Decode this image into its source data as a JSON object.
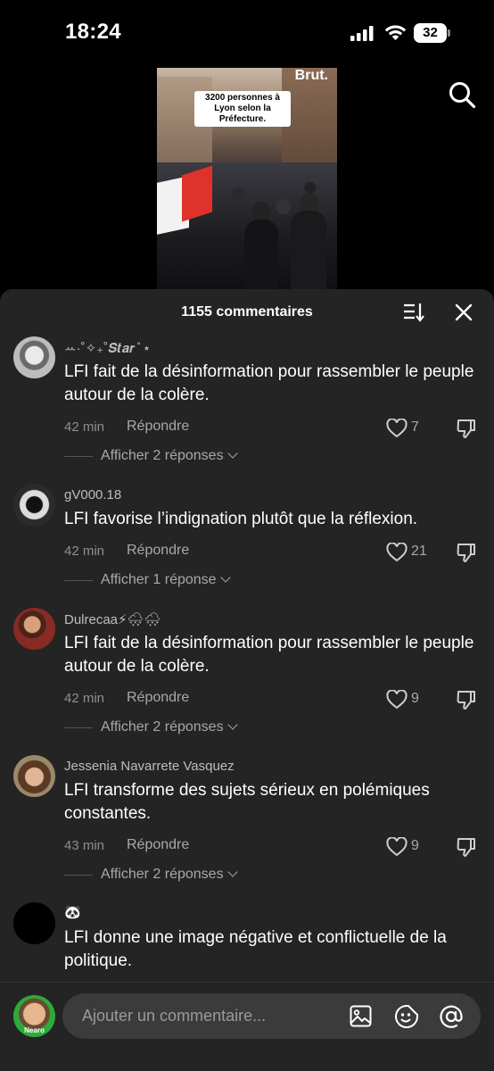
{
  "status_bar": {
    "time": "18:24",
    "battery": "32"
  },
  "video": {
    "brand": "Brut.",
    "caption": "3200 personnes à Lyon selon la Préfecture."
  },
  "sheet": {
    "comment_count": "1155 commentaires"
  },
  "comments": [
    {
      "user": "ꕀ·˚✧₊˚𝑺𝒕𝒂𝒓 ̊ ⋆",
      "text": "LFI fait de la désinformation pour rassembler le peuple autour de la colère.",
      "time": "42 min",
      "reply_label": "Répondre",
      "likes": "7",
      "show_replies": "Afficher 2 réponses"
    },
    {
      "user": "gV000.18",
      "text": "LFI favorise l’indignation plutôt que la réflexion.",
      "time": "42 min",
      "reply_label": "Répondre",
      "likes": "21",
      "show_replies": "Afficher 1 réponse"
    },
    {
      "user": "Dulrecaa⚡🌨🌨",
      "text": "LFI fait de la désinformation pour rassembler le peuple autour de la colère.",
      "time": "42 min",
      "reply_label": "Répondre",
      "likes": "9",
      "show_replies": "Afficher 2 réponses"
    },
    {
      "user": "Jessenia Navarrete Vasquez",
      "text": "LFI transforme des sujets sérieux en polémiques constantes.",
      "time": "43 min",
      "reply_label": "Répondre",
      "likes": "9",
      "show_replies": "Afficher 2 réponses"
    },
    {
      "user": "🐼",
      "text": "LFI donne une image négative et conflictuelle de la politique."
    }
  ],
  "composer": {
    "placeholder": "Ajouter un commentaire...",
    "avatar_badge": "Nearo"
  }
}
